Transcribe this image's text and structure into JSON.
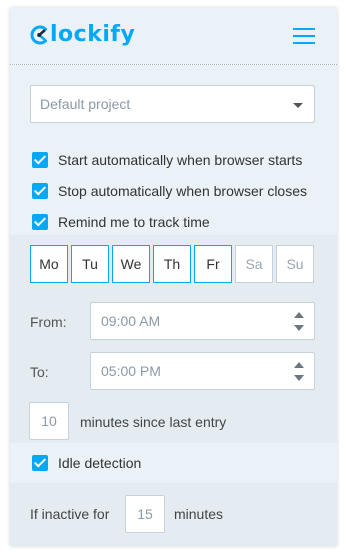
{
  "header": {
    "logo_text": "lockify",
    "brand_color": "#03a9f4",
    "menu_icon": "hamburger-menu-icon"
  },
  "project_select": {
    "value": "Default project"
  },
  "options": [
    {
      "label": "Start automatically when browser starts",
      "checked": true
    },
    {
      "label": "Stop automatically when browser closes",
      "checked": true
    },
    {
      "label": "Remind me to track time",
      "checked": true
    }
  ],
  "schedule": {
    "days": [
      {
        "label": "Mo",
        "active": true
      },
      {
        "label": "Tu",
        "active": true
      },
      {
        "label": "We",
        "active": true
      },
      {
        "label": "Th",
        "active": true
      },
      {
        "label": "Fr",
        "active": true
      },
      {
        "label": "Sa",
        "active": false
      },
      {
        "label": "Su",
        "active": false
      }
    ],
    "from_label": "From:",
    "from_value": "09:00 AM",
    "to_label": "To:",
    "to_value": "05:00 PM",
    "minutes_value": "10",
    "minutes_text": "minutes since last entry"
  },
  "idle": {
    "label": "Idle detection",
    "checked": true,
    "inactive_prefix": "If inactive for",
    "inactive_value": "15",
    "inactive_suffix": "minutes"
  }
}
